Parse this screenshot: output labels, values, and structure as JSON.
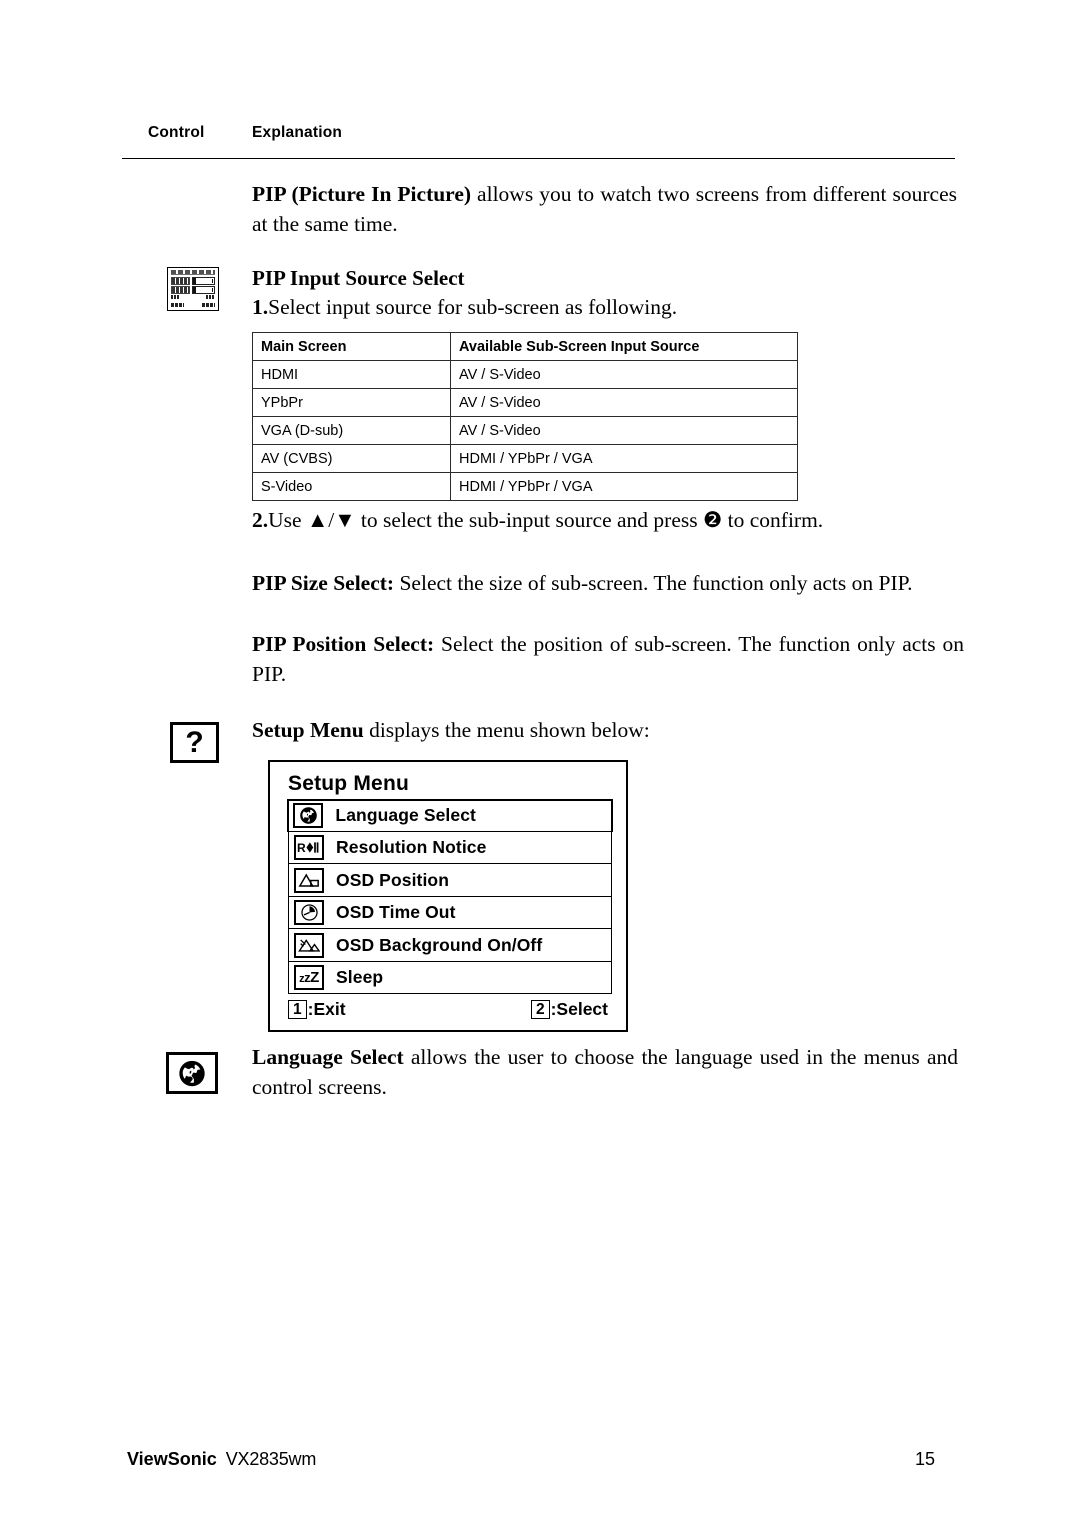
{
  "header": {
    "control_label": "Control",
    "explanation_label": "Explanation"
  },
  "intro": {
    "bold_lead": "PIP (Picture In Picture)",
    "rest": " allows you to watch two screens from different sources at the same time."
  },
  "pip_input_source": {
    "heading": "PIP Input Source Select",
    "step1_number": "1.",
    "step1_text": "Select input source for sub-screen as following.",
    "table": {
      "columns": [
        "Main Screen",
        "Available Sub-Screen Input Source"
      ],
      "rows": [
        [
          "HDMI",
          "AV / S-Video"
        ],
        [
          "YPbPr",
          "AV / S-Video"
        ],
        [
          "VGA (D-sub)",
          "AV / S-Video"
        ],
        [
          "AV (CVBS)",
          "HDMI / YPbPr / VGA"
        ],
        [
          "S-Video",
          "HDMI / YPbPr / VGA"
        ]
      ]
    },
    "step2_number": "2.",
    "step2_text_a": "Use ",
    "step2_arrows": "▲/▼",
    "step2_text_b": " to select the sub-input source and press ",
    "step2_button": "❷",
    "step2_text_c": " to confirm.",
    "icon": "contrast-brightness-osd-thumbnail-icon"
  },
  "pip_size": {
    "bold_lead": "PIP Size Select:",
    "rest": " Select the size of sub-screen. The function only acts on PIP."
  },
  "pip_position": {
    "bold_lead": "PIP Position Select:",
    "rest": " Select the position of sub-screen. The function only acts on PIP."
  },
  "setup": {
    "icon": "question-mark-icon",
    "icon_glyph": "?",
    "bold_lead": "Setup Menu",
    "rest": " displays the menu shown below:",
    "osd": {
      "title": "Setup Menu",
      "items": [
        {
          "label": "Language Select",
          "icon": "globe-icon",
          "selected": true
        },
        {
          "label": "Resolution Notice",
          "icon": "resolution-notice-icon",
          "selected": false
        },
        {
          "label": "OSD Position",
          "icon": "osd-position-icon",
          "selected": false
        },
        {
          "label": "OSD Time Out",
          "icon": "clock-icon",
          "selected": false
        },
        {
          "label": "OSD Background On/Off",
          "icon": "landscape-icon",
          "selected": false
        },
        {
          "label": "Sleep",
          "icon": "sleep-zzz-icon",
          "selected": false
        }
      ],
      "footer": {
        "exit_key": "1",
        "exit_label": ":Exit",
        "select_key": "2",
        "select_label": ":Select"
      }
    }
  },
  "language_select": {
    "icon": "globe-icon",
    "bold_lead": "Language Select",
    "rest": " allows the user to choose the language used in the menus and control screens."
  },
  "footer": {
    "brand": "ViewSonic",
    "model": "VX2835wm",
    "page_number": "15"
  }
}
